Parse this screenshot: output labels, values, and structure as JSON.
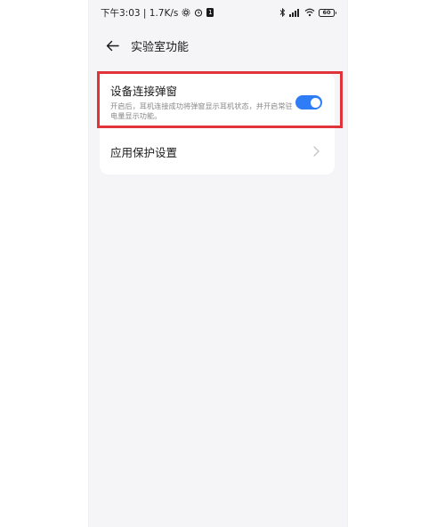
{
  "status_bar": {
    "time_speed": "下午3:03 | 1.7K/s",
    "sim_badge": "1",
    "battery": "60",
    "icons": [
      "settings-icon",
      "alarm-icon",
      "sim-icon",
      "bluetooth-icon",
      "signal-icon",
      "wifi-icon",
      "battery-icon"
    ]
  },
  "header": {
    "back_icon": "arrow-left-icon",
    "title": "实验室功能"
  },
  "settings": {
    "device_popup": {
      "title": "设备连接弹窗",
      "description": "开启后，耳机连接成功将弹窗显示耳机状态，并开启常驻电量显示功能。",
      "enabled": true
    },
    "app_protection": {
      "label": "应用保护设置",
      "icon": "chevron-right-icon"
    }
  },
  "colors": {
    "toggle_on": "#2f7df6",
    "highlight": "#e0343a",
    "background": "#f5f5f7"
  }
}
